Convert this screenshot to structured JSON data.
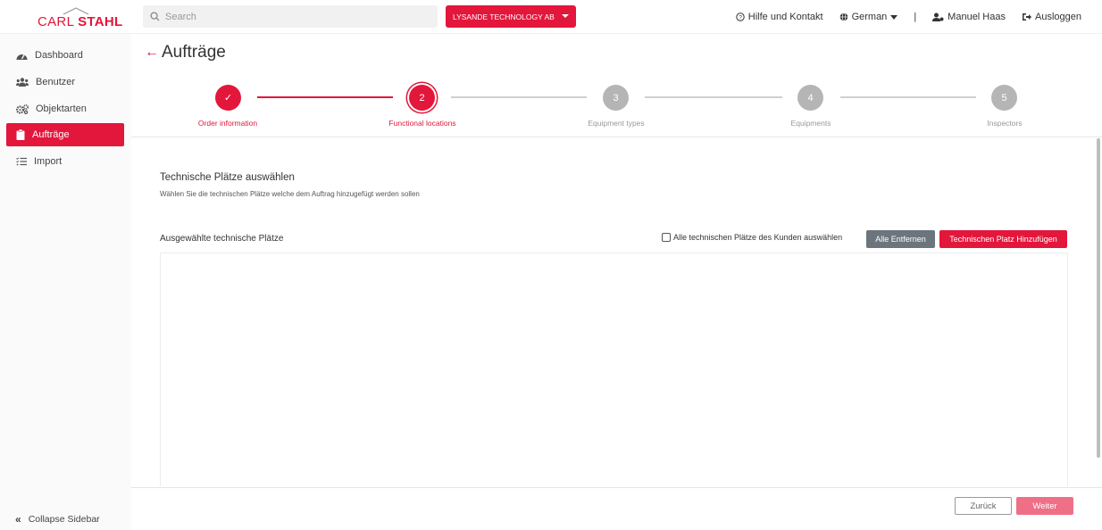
{
  "brand": {
    "logo_part1": "CARL",
    "logo_part2": "STAHL",
    "accent": "#e3163b"
  },
  "header": {
    "search_placeholder": "Search",
    "company": "LYSANDE TECHNOLOGY AB",
    "help": "Hilfe und Kontakt",
    "language": "German",
    "separator": "|",
    "user": "Manuel Haas",
    "logout": "Ausloggen"
  },
  "sidebar": {
    "items": [
      {
        "label": "Dashboard",
        "icon": "dashboard-icon"
      },
      {
        "label": "Benutzer",
        "icon": "users-icon"
      },
      {
        "label": "Objektarten",
        "icon": "cogs-icon"
      },
      {
        "label": "Aufträge",
        "icon": "clipboard-icon",
        "active": true
      },
      {
        "label": "Import",
        "icon": "list-icon"
      }
    ],
    "collapse_icon": "«",
    "collapse_label": "Collapse Sidebar"
  },
  "page": {
    "back_icon": "←",
    "title": "Aufträge"
  },
  "stepper": {
    "steps": [
      {
        "number": "✓",
        "label": "Order information",
        "state": "done"
      },
      {
        "number": "2",
        "label": "Functional locations",
        "state": "current"
      },
      {
        "number": "3",
        "label": "Equipment types",
        "state": "pending"
      },
      {
        "number": "4",
        "label": "Equipments",
        "state": "pending"
      },
      {
        "number": "5",
        "label": "Inspectors",
        "state": "pending"
      }
    ]
  },
  "content": {
    "title": "Technische Plätze auswählen",
    "subtitle": "Wählen Sie die technischen Plätze welche dem Auftrag hinzugefügt werden sollen",
    "selected_label": "Ausgewählte technische Plätze",
    "select_all_label": "Alle technischen Plätze des Kunden auswählen",
    "remove_all": "Alle Entfernen",
    "add_location": "Technischen Platz Hinzufügen"
  },
  "footer": {
    "back": "Zurück",
    "next": "Weiter"
  }
}
